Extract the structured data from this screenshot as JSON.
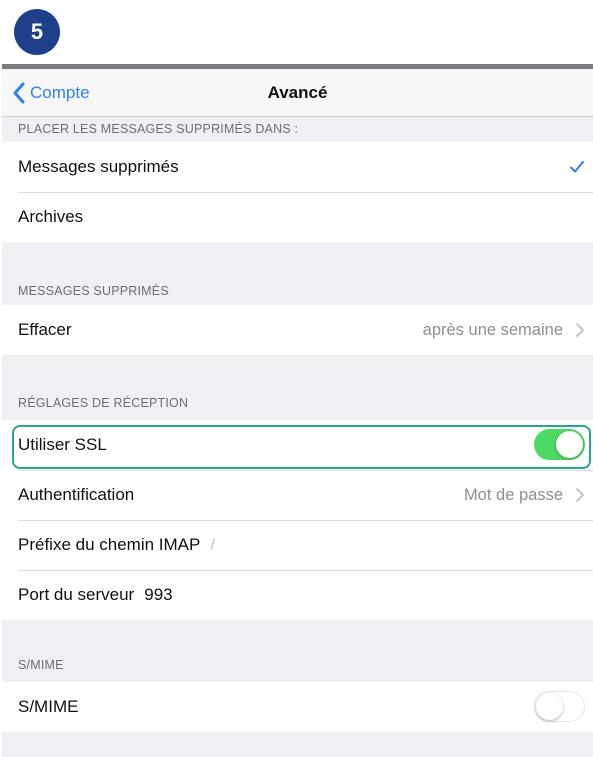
{
  "step_badge": "5",
  "navbar": {
    "back_label": "Compte",
    "title": "Avancé"
  },
  "sections": {
    "deleted_destination": {
      "header": "PLACER LES MESSAGES SUPPRIMÉS DANS :",
      "options": [
        {
          "label": "Messages supprimés",
          "selected": true
        },
        {
          "label": "Archives",
          "selected": false
        }
      ]
    },
    "deleted_messages": {
      "header": "MESSAGES SUPPRIMÉS",
      "erase_label": "Effacer",
      "erase_value": "après une semaine"
    },
    "incoming": {
      "header": "RÉGLAGES DE RÉCEPTION",
      "use_ssl_label": "Utiliser SSL",
      "use_ssl_on": true,
      "auth_label": "Authentification",
      "auth_value": "Mot de passe",
      "imap_prefix_label": "Préfixe du chemin IMAP",
      "imap_prefix_value": "/",
      "server_port_label": "Port du serveur",
      "server_port_value": "993"
    },
    "smime": {
      "header": "S/MIME",
      "smime_label": "S/MIME",
      "smime_on": false
    }
  },
  "colors": {
    "accent": "#2f7ff6",
    "toggle_on": "#4cd964",
    "highlight": "#26a889",
    "badge": "#1e3f8a"
  },
  "icons": [
    "chevron-left-icon",
    "checkmark-icon",
    "chevron-right-icon"
  ]
}
